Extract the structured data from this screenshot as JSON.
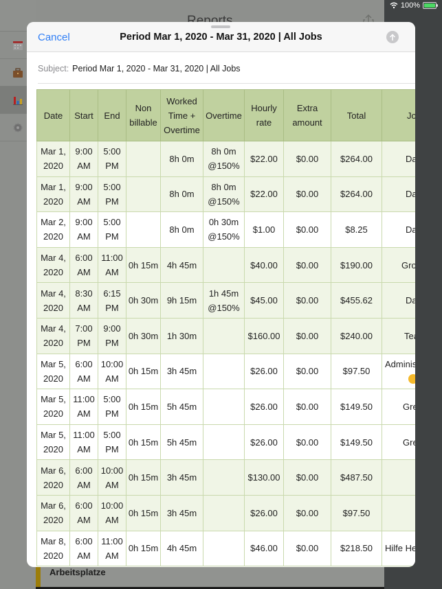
{
  "status_bar": {
    "battery_percent": "100%",
    "wifi_icon": "wifi-icon",
    "battery_icon": "battery-charging-icon"
  },
  "backdrop": {
    "title": "Reports",
    "share_icon": "share-icon",
    "sidebar_items": [
      {
        "icon": "calendar-icon",
        "active": false
      },
      {
        "icon": "briefcase-icon",
        "active": false
      },
      {
        "icon": "bar-chart-icon",
        "active": true
      },
      {
        "icon": "gear-icon",
        "active": false
      }
    ],
    "section_label": "Arbeitsplatze"
  },
  "sheet": {
    "cancel_label": "Cancel",
    "title": "Period Mar 1, 2020 - Mar 31, 2020 | All Jobs",
    "send_icon": "arrow-up-icon",
    "subject_label": "Subject:",
    "subject_value": "Period Mar 1, 2020 - Mar 31, 2020 | All Jobs"
  },
  "table": {
    "headers": [
      "Date",
      "Start",
      "End",
      "Non billable",
      "Worked Time + Overtime",
      "Overtime",
      "Hourly rate",
      "Extra amount",
      "Total",
      "Jo"
    ],
    "rows": [
      {
        "shade": true,
        "cells": [
          "Mar 1, 2020",
          "9:00 AM",
          "5:00 PM",
          "",
          "8h 0m",
          "8h 0m @150%",
          "$22.00",
          "$0.00",
          "$264.00",
          "Day"
        ]
      },
      {
        "shade": true,
        "cells": [
          "Mar 1, 2020",
          "9:00 AM",
          "5:00 PM",
          "",
          "8h 0m",
          "8h 0m @150%",
          "$22.00",
          "$0.00",
          "$264.00",
          "Day"
        ]
      },
      {
        "shade": false,
        "cells": [
          "Mar 2, 2020",
          "9:00 AM",
          "5:00 PM",
          "",
          "8h 0m",
          "0h 30m @150%",
          "$1.00",
          "$0.00",
          "$8.25",
          "Day"
        ]
      },
      {
        "shade": true,
        "cells": [
          "Mar 4, 2020",
          "6:00 AM",
          "11:00 AM",
          "0h 15m",
          "4h 45m",
          "",
          "$40.00",
          "$0.00",
          "$190.00",
          "Group"
        ]
      },
      {
        "shade": true,
        "cells": [
          "Mar 4, 2020",
          "8:30 AM",
          "6:15 PM",
          "0h 30m",
          "9h 15m",
          "1h 45m @150%",
          "$45.00",
          "$0.00",
          "$455.62",
          "Day"
        ]
      },
      {
        "shade": true,
        "cells": [
          "Mar 4, 2020",
          "7:00 PM",
          "9:00 PM",
          "0h 30m",
          "1h 30m",
          "",
          "$160.00",
          "$0.00",
          "$240.00",
          "Teach"
        ]
      },
      {
        "shade": false,
        "cells": [
          "Mar 5, 2020",
          "6:00 AM",
          "10:00 AM",
          "0h 15m",
          "3h 45m",
          "",
          "$26.00",
          "$0.00",
          "$97.50",
          "Adminis 😀"
        ]
      },
      {
        "shade": false,
        "cells": [
          "Mar 5, 2020",
          "11:00 AM",
          "5:00 PM",
          "0h 15m",
          "5h 45m",
          "",
          "$26.00",
          "$0.00",
          "$149.50",
          "Greg's"
        ]
      },
      {
        "shade": false,
        "cells": [
          "Mar 5, 2020",
          "11:00 AM",
          "5:00 PM",
          "0h 15m",
          "5h 45m",
          "",
          "$26.00",
          "$0.00",
          "$149.50",
          "Greg's"
        ]
      },
      {
        "shade": true,
        "cells": [
          "Mar 6, 2020",
          "6:00 AM",
          "10:00 AM",
          "0h 15m",
          "3h 45m",
          "",
          "$130.00",
          "$0.00",
          "$487.50",
          ""
        ]
      },
      {
        "shade": true,
        "cells": [
          "Mar 6, 2020",
          "6:00 AM",
          "10:00 AM",
          "0h 15m",
          "3h 45m",
          "",
          "$26.00",
          "$0.00",
          "$97.50",
          ""
        ]
      },
      {
        "shade": false,
        "cells": [
          "Mar 8, 2020",
          "6:00 AM",
          "11:00 AM",
          "0h 15m",
          "4h 45m",
          "",
          "$46.00",
          "$0.00",
          "$218.50",
          "Hilfe He"
        ]
      }
    ]
  }
}
